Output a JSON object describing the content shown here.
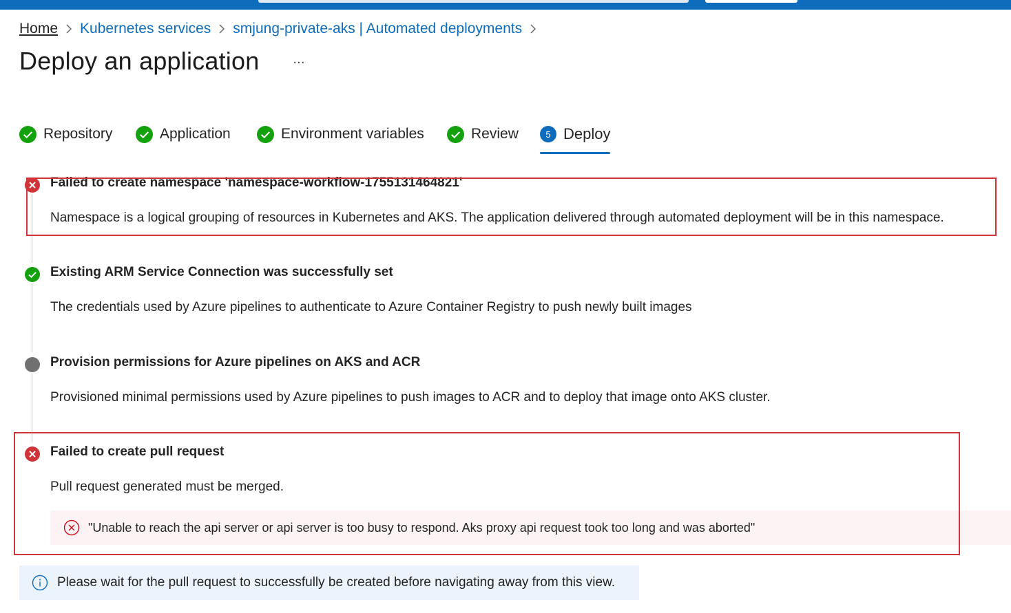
{
  "breadcrumb": {
    "home": "Home",
    "kubernetes_services": "Kubernetes services",
    "cluster_deployments": "smjung-private-aks | Automated deployments"
  },
  "page": {
    "title": "Deploy an application",
    "more_label": "···"
  },
  "tabs": [
    {
      "label": "Repository",
      "status": "complete"
    },
    {
      "label": "Application",
      "status": "complete"
    },
    {
      "label": "Environment variables",
      "status": "complete"
    },
    {
      "label": "Review",
      "status": "complete"
    },
    {
      "label": "Deploy",
      "status": "active",
      "number": "5"
    }
  ],
  "steps": [
    {
      "status": "error",
      "title": "Failed to create namespace 'namespace-workflow-1755131464821'",
      "description": "Namespace is a logical grouping of resources in Kubernetes and AKS. The application delivered through automated deployment will be in this namespace."
    },
    {
      "status": "success",
      "title": "Existing ARM Service Connection was successfully set",
      "description": "The credentials used by Azure pipelines to authenticate to Azure Container Registry to push newly built images"
    },
    {
      "status": "pending",
      "title": "Provision permissions for Azure pipelines on AKS and ACR",
      "description": "Provisioned minimal permissions used by Azure pipelines to push images to ACR and to deploy that image onto AKS cluster."
    },
    {
      "status": "error",
      "title": "Failed to create pull request",
      "description": "Pull request generated must be merged."
    }
  ],
  "error_message": "\"Unable to reach the api server or api server is too busy to respond. Aks proxy api request took too long and was aborted\"",
  "info_message": "Please wait for the pull request to successfully be created before navigating away from this view.",
  "colors": {
    "accent": "#0f6cbd",
    "success": "#13a10e",
    "error": "#d13438",
    "pending": "#707070"
  }
}
